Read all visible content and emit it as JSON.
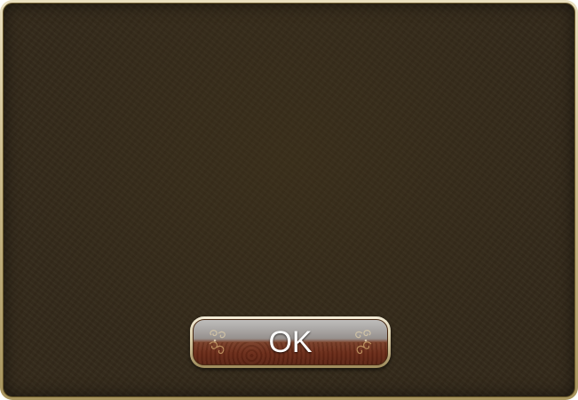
{
  "dialog": {
    "ok_button": {
      "label": "OK",
      "icons": [
        "flourish-ornament-icon",
        "flourish-ornament-icon"
      ]
    }
  },
  "colors": {
    "panel_background": "#33291a",
    "frame_gold": "#cdbd8f",
    "button_top": "#8c8683",
    "button_bottom": "#6a2a17",
    "button_text": "#ffffff"
  }
}
